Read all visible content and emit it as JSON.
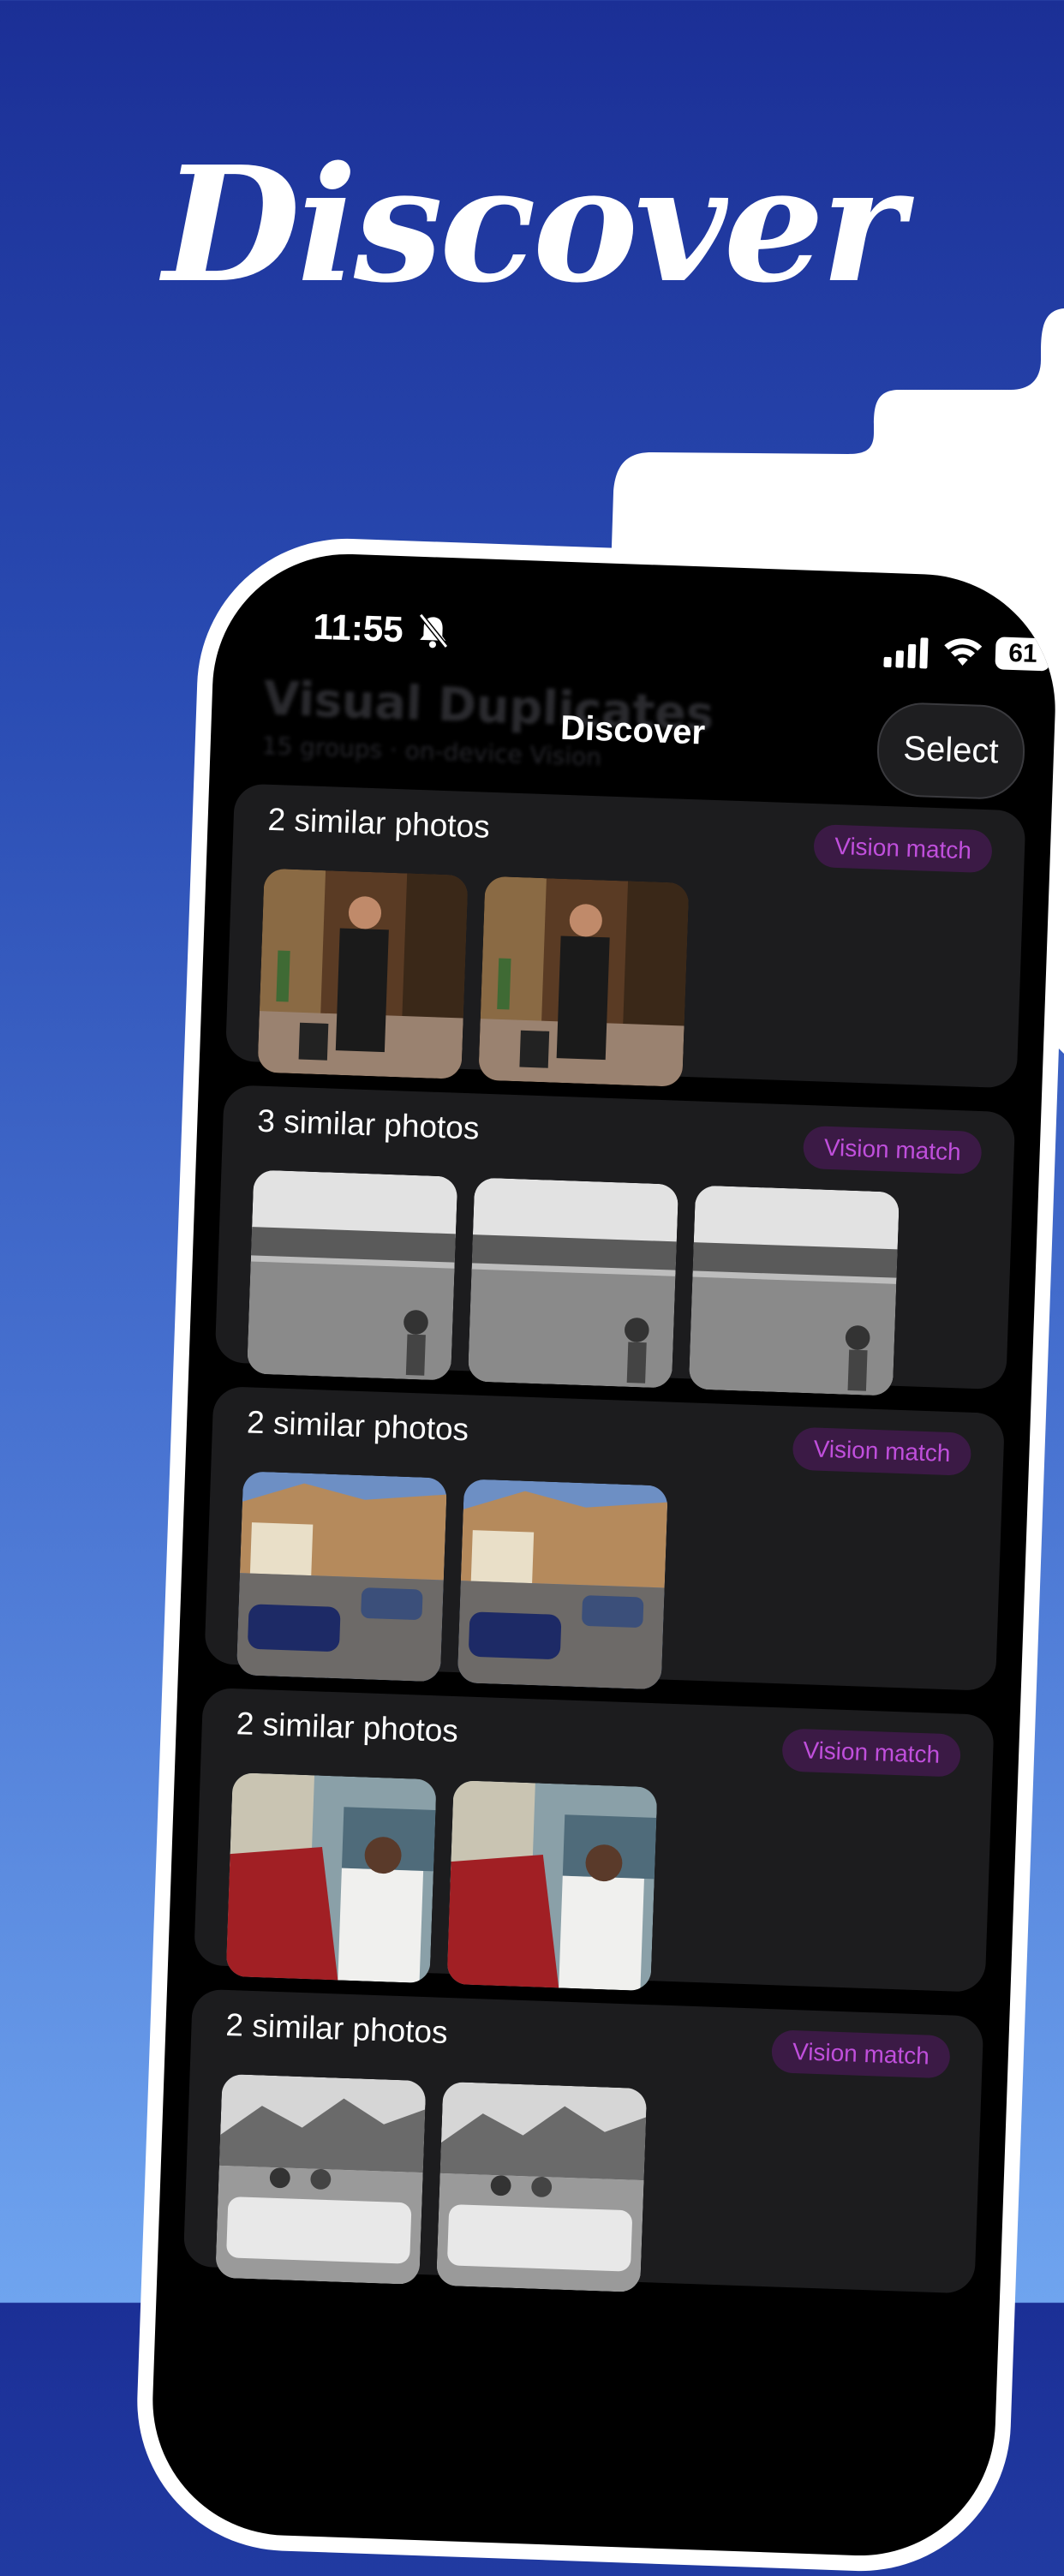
{
  "hero": {
    "title": "Discover"
  },
  "status_bar": {
    "time": "11:55",
    "battery": "61"
  },
  "background_header": {
    "title": "Visual Duplicates",
    "subtitle": "15 groups · on-device Vision"
  },
  "nav": {
    "title": "Discover",
    "select_label": "Select"
  },
  "groups": [
    {
      "title": "2 similar photos",
      "badge": "Vision match",
      "photo_count": 2,
      "photo_style": "hotel"
    },
    {
      "title": "3 similar photos",
      "badge": "Vision match",
      "photo_count": 3,
      "photo_style": "street-bw"
    },
    {
      "title": "2 similar photos",
      "badge": "Vision match",
      "photo_count": 2,
      "photo_style": "cars-color"
    },
    {
      "title": "2 similar photos",
      "badge": "Vision match",
      "photo_count": 2,
      "photo_style": "market"
    },
    {
      "title": "2 similar photos",
      "badge": "Vision match",
      "photo_count": 2,
      "photo_style": "jeep-bw"
    }
  ],
  "colors": {
    "accent_badge_text": "#c04fdc",
    "accent_badge_bg": "#3b1a45",
    "card_bg": "#1c1c1e",
    "background_top": "#1b2f96",
    "background_bottom": "#6fa4ef"
  }
}
